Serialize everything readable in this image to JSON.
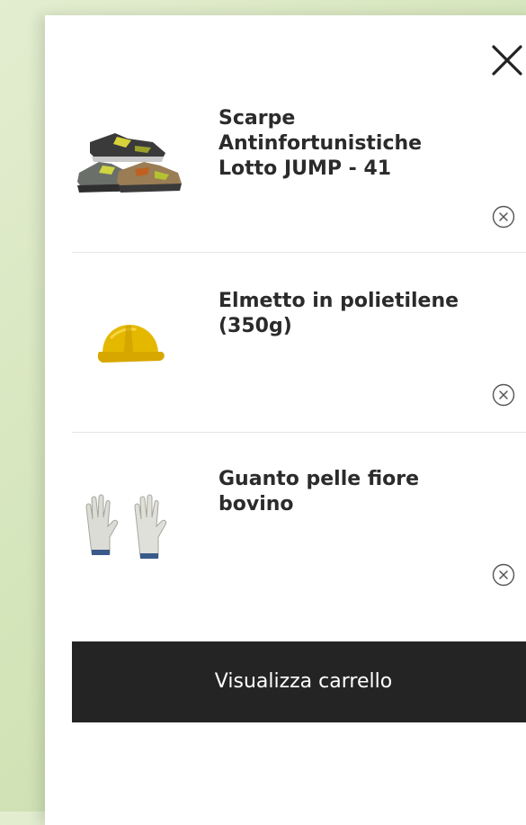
{
  "mini_cart": {
    "close_icon": "close-icon",
    "items": [
      {
        "name": "Scarpe Antinfortunistiche Lotto JUMP - 41",
        "thumb_icon": "safety-shoes-icon",
        "remove_icon": "remove-circle-icon"
      },
      {
        "name": "Elmetto in polietilene (350g)",
        "thumb_icon": "safety-helmet-icon",
        "remove_icon": "remove-circle-icon"
      },
      {
        "name": "Guanto pelle fiore bovino",
        "thumb_icon": "leather-gloves-icon",
        "remove_icon": "remove-circle-icon"
      }
    ],
    "view_cart_label": "Visualizza carrello"
  },
  "colors": {
    "background": "#d6e6bd",
    "panel": "#ffffff",
    "button": "#242424",
    "button_text": "#ffffff",
    "text": "#2b2b2b",
    "divider": "#e6e6e6"
  }
}
